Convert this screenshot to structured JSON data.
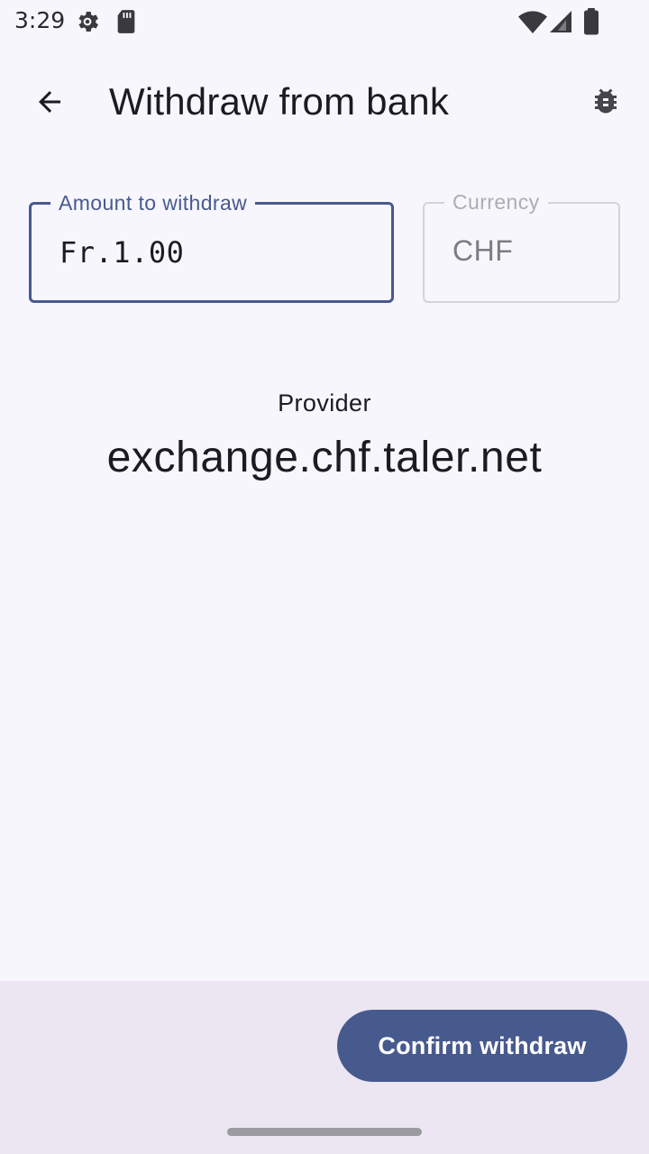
{
  "status_bar": {
    "time": "3:29",
    "icons": [
      "settings-gear-icon",
      "sd-card-icon",
      "wifi-icon",
      "cellular-signal-icon",
      "battery-icon"
    ]
  },
  "app_bar": {
    "title": "Withdraw from bank",
    "back_icon": "arrow-back-icon",
    "action_icon": "bug-icon"
  },
  "form": {
    "amount": {
      "label": "Amount to withdraw",
      "value": "Fr.1.00"
    },
    "currency": {
      "label": "Currency",
      "value": "CHF"
    }
  },
  "provider": {
    "label": "Provider",
    "value": "exchange.chf.taler.net"
  },
  "actions": {
    "confirm_label": "Confirm withdraw"
  },
  "colors": {
    "primary": "#475a8e",
    "background": "#f7f6fd",
    "bottom_bar": "#ebe6f1",
    "outline_muted": "#d4d3dc"
  }
}
